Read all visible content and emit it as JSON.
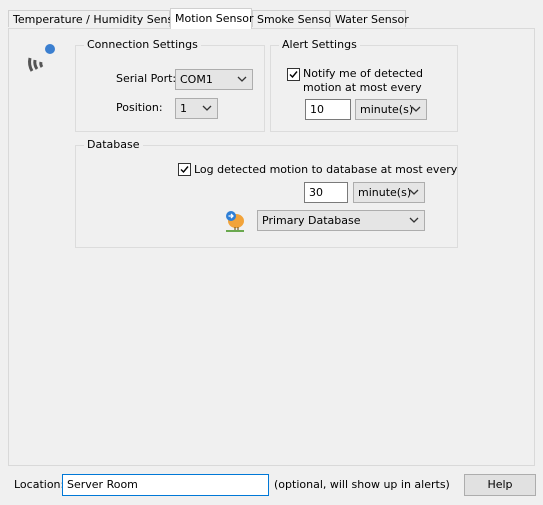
{
  "tabs": [
    {
      "label": "Temperature / Humidity Sensor"
    },
    {
      "label": "Motion Sensor"
    },
    {
      "label": "Smoke Sensor"
    },
    {
      "label": "Water Sensor"
    }
  ],
  "connection": {
    "title": "Connection Settings",
    "serial_port_label": "Serial Port:",
    "serial_port_value": "COM1",
    "position_label": "Position:",
    "position_value": "1"
  },
  "alert": {
    "title": "Alert Settings",
    "notify_checked": true,
    "notify_label_line1": "Notify me of detected",
    "notify_label_line2": "motion at most every",
    "interval_value": "10",
    "interval_unit": "minute(s)"
  },
  "database": {
    "title": "Database",
    "log_checked": true,
    "log_label": "Log detected motion to database at most every",
    "interval_value": "30",
    "interval_unit": "minute(s)",
    "database_value": "Primary Database"
  },
  "footer": {
    "location_label": "Location:",
    "location_value": "Server Room",
    "location_hint": "(optional, will show up in alerts)",
    "help_label": "Help"
  },
  "colors": {
    "accent": "#0078d7",
    "sensor_dot": "#3b7fd0"
  },
  "icons": {
    "sensor": "motion-sensor-icon",
    "database": "database-bird-icon"
  }
}
